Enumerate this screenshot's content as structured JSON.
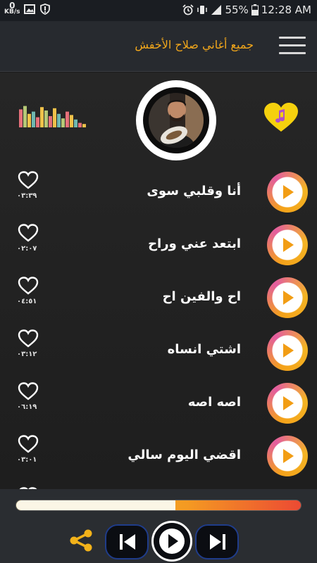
{
  "status_bar": {
    "speed_value": "0",
    "speed_unit": "KB/s",
    "battery": "55%",
    "time": "12:28 AM"
  },
  "app_bar": {
    "title": "جميع أغاني صلاح الأخفش",
    "menu_icon": "hamburger-icon"
  },
  "header": {
    "equalizer_icon": "equalizer-icon",
    "favorite_icon": "music-heart-icon",
    "equalizer_bars": [
      0.8,
      0.95,
      0.6,
      0.7,
      0.45,
      0.9,
      0.75,
      0.5,
      0.85,
      0.6,
      0.4,
      0.7,
      0.55,
      0.35,
      0.2,
      0.15
    ],
    "equalizer_colors": [
      "#e6707a",
      "#b5c776",
      "#f0c24a",
      "#6fb8b0",
      "#e6707a",
      "#f0c24a",
      "#b5c776",
      "#e6707a",
      "#f0c24a",
      "#6fb8b0",
      "#b5c776",
      "#e6707a",
      "#f0c24a",
      "#6fb8b0",
      "#e6707a",
      "#f0c24a"
    ]
  },
  "songs": [
    {
      "title": "أنا وقلبي سوى",
      "duration": "٠٣:٣٩"
    },
    {
      "title": "ابتعد عني وراح",
      "duration": "٠٢:٠٧"
    },
    {
      "title": "اح والفين اح",
      "duration": "٠٤:٥١"
    },
    {
      "title": "اشتي انساه",
      "duration": "٠٣:١٢"
    },
    {
      "title": "اصه اصه",
      "duration": "٠٦:١٩"
    },
    {
      "title": "اقضي اليوم سالي",
      "duration": "٠٣:٠١"
    }
  ],
  "player": {
    "progress": 0.56,
    "share_icon": "share-icon",
    "prev_icon": "skip-previous-icon",
    "play_icon": "play-icon",
    "next_icon": "skip-next-icon"
  },
  "colors": {
    "accent": "#f2a71b",
    "background": "#1e1e1e",
    "appbar": "#272a2f"
  }
}
